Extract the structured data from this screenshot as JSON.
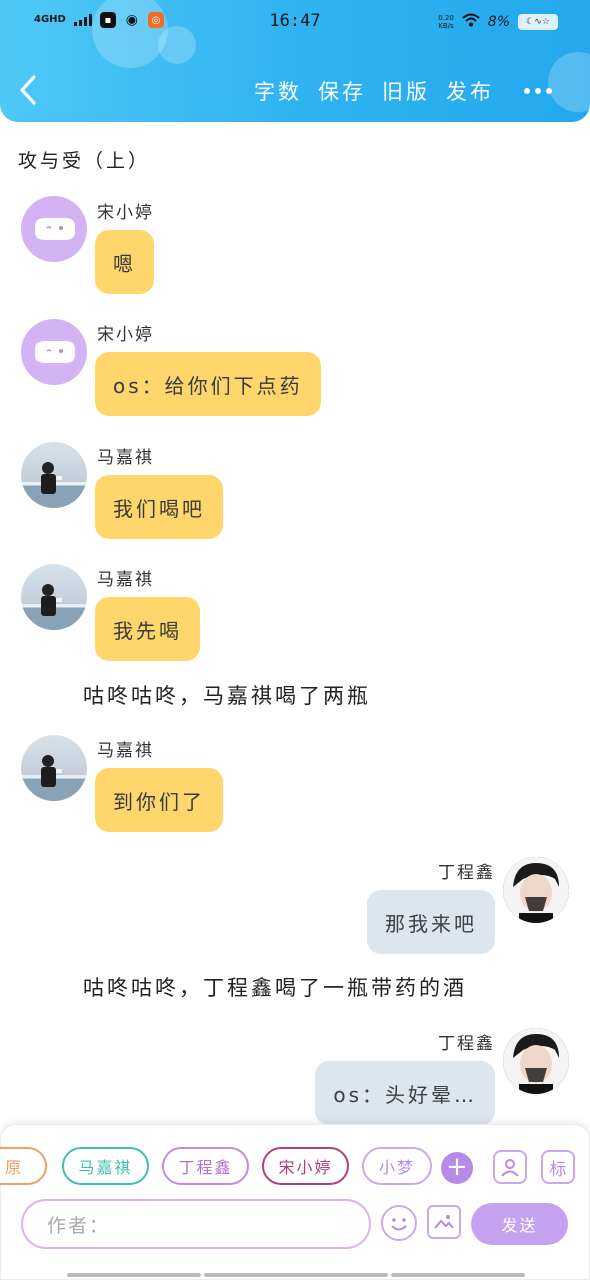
{
  "status_bar": {
    "network": "4GHD",
    "time": "16:47",
    "net_speed": "0.20\nKB/s",
    "battery_pct": "8%"
  },
  "header": {
    "back_icon": "chevron-left-icon",
    "actions": [
      "字数",
      "保存",
      "旧版",
      "发布"
    ],
    "more_icon": "more-dots-icon",
    "colors": {
      "gradient_start": "#4fc8f6",
      "gradient_end": "#23a8ee"
    }
  },
  "chapter_title": "攻与受（上）",
  "messages": [
    {
      "type": "left",
      "sender": "宋小婷",
      "text": "嗯",
      "avatar": "purple-cloud-avatar"
    },
    {
      "type": "left",
      "sender": "宋小婷",
      "text": "os：给你们下点药",
      "avatar": "purple-cloud-avatar"
    },
    {
      "type": "left",
      "sender": "马嘉祺",
      "text": "我们喝吧",
      "avatar": "photo-avatar"
    },
    {
      "type": "left",
      "sender": "马嘉祺",
      "text": "我先喝",
      "avatar": "photo-avatar"
    },
    {
      "type": "narration",
      "text": "咕咚咕咚，马嘉祺喝了两瓶"
    },
    {
      "type": "left",
      "sender": "马嘉祺",
      "text": "到你们了",
      "avatar": "photo-avatar"
    },
    {
      "type": "right",
      "sender": "丁程鑫",
      "text": "那我来吧",
      "avatar": "photo-avatar"
    },
    {
      "type": "narration",
      "text": "咕咚咕咚，丁程鑫喝了一瓶带药的酒"
    },
    {
      "type": "right",
      "sender": "丁程鑫",
      "text": "os：头好晕…",
      "avatar": "photo-avatar"
    }
  ],
  "bottom": {
    "chips": [
      {
        "label": "原",
        "color": "#f0a060"
      },
      {
        "label": "马嘉祺",
        "color": "#3fbfb0"
      },
      {
        "label": "丁程鑫",
        "color": "#c58ae0"
      },
      {
        "label": "宋小婷",
        "color": "#b0407a"
      },
      {
        "label": "小梦",
        "color": "#b58be6"
      }
    ],
    "add_label": "+",
    "tag_label": "标",
    "author_placeholder": "作者：",
    "send_label": "发送",
    "accent": "#c4a2f0"
  }
}
